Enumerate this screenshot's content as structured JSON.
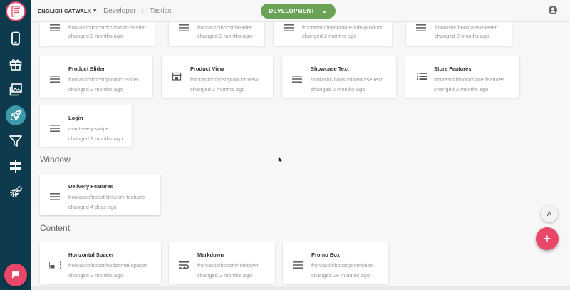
{
  "header": {
    "project": "ENGLISH CATWALK",
    "breadcrumb": [
      "Developer",
      "Tastics"
    ],
    "environment": "DEVELOPMENT"
  },
  "sidebar": {
    "items": [
      {
        "icon": "mobile-icon",
        "active": false
      },
      {
        "icon": "gift-icon",
        "active": false
      },
      {
        "icon": "gallery-icon",
        "active": false
      },
      {
        "icon": "rocket-icon",
        "active": true
      },
      {
        "icon": "filter-icon",
        "active": false
      },
      {
        "icon": "signpost-icon",
        "active": false
      },
      {
        "icon": "settings-icon",
        "active": false
      }
    ]
  },
  "top_row": [
    {
      "path": "frontastic/boost/frontastic-header",
      "changed": "changed 2 months ago",
      "icon": "menu-icon"
    },
    {
      "path": "frontastic/boost/header",
      "changed": "changed 2 months ago",
      "icon": "menu-icon"
    },
    {
      "path": "frontastic/boost/more-info-product",
      "changed": "changed 2 months ago",
      "icon": "menu-icon"
    },
    {
      "path": "frontastic/boost/newsletter",
      "changed": "changed 2 months ago",
      "icon": "menu-icon"
    }
  ],
  "row2": [
    {
      "title": "Product Slider",
      "path": "frontastic/boost/product-slider",
      "changed": "changed 2 months ago",
      "icon": "menu-icon"
    },
    {
      "title": "Product View",
      "path": "frontastic/boost/product-view",
      "changed": "changed 2 months ago",
      "icon": "shop-icon"
    },
    {
      "title": "Showcase Text",
      "path": "frontastic/boost/showcase-text",
      "changed": "changed 2 months ago",
      "icon": "menu-icon"
    },
    {
      "title": "Store Features",
      "path": "frontastic/boost/store-features",
      "changed": "changed 2 months ago",
      "icon": "list-icon"
    }
  ],
  "row3": [
    {
      "title": "Login",
      "path": "react-easy-swipe",
      "changed": "changed 2 months ago",
      "icon": "menu-icon"
    }
  ],
  "sections": {
    "window": {
      "heading": "Window",
      "cards": [
        {
          "title": "Delivery Features",
          "path": "frontastic/boost/delivery-features",
          "changed": "changed 4 days ago",
          "icon": "menu-icon"
        }
      ]
    },
    "content": {
      "heading": "Content",
      "cards": [
        {
          "title": "Horizontal Spacer",
          "path": "frontastic/boost/horizontal-spacer",
          "changed": "changed 2 months ago",
          "icon": "spacer-icon"
        },
        {
          "title": "Markdown",
          "path": "frontastic/boost/markdown",
          "changed": "changed 2 months ago",
          "icon": "wrap-icon"
        },
        {
          "title": "Promo Box",
          "path": "frontastic/boost/promobox",
          "changed": "changed 26 minutes ago",
          "icon": "menu-icon"
        }
      ]
    }
  },
  "colors": {
    "sidebar": "#0d3a4c",
    "accent": "#e8476a",
    "environment": "#6aa355",
    "active_nav": "#3d9aab"
  },
  "fab": {
    "format_label": "A",
    "add_label": "+"
  }
}
